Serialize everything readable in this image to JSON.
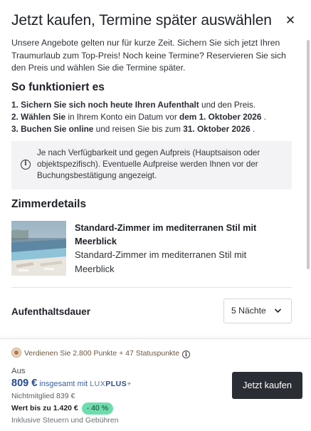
{
  "header": {
    "title": "Jetzt kaufen, Termine später auswählen",
    "close_icon": "close-icon"
  },
  "intro": "Unsere Angebote gelten nur für kurze Zeit. Sichern Sie sich jetzt Ihren Traumurlaub zum Top-Preis! Noch keine Termine? Reservieren Sie sich den Preis und wählen Sie die Termine später.",
  "how": {
    "title": "So funktioniert es",
    "steps": [
      {
        "bold": "1. Sichern Sie sich noch heute Ihren Aufenthalt",
        "rest": " und den Preis."
      },
      {
        "bold": "2. Wählen Sie",
        "mid": " in Ihrem Konto ein Datum vor ",
        "bold2": "dem 1. Oktober 2026 ",
        "end": "."
      },
      {
        "bold": "3. Buchen Sie online",
        "mid": " und reisen Sie bis zum ",
        "bold2": "31. Oktober 2026",
        "end": " ."
      }
    ]
  },
  "info": {
    "icon": "info-icon",
    "text": "Je nach Verfügbarkeit und gegen Aufpreis (Hauptsaison oder objektspezifisch). Eventuelle Aufpreise werden Ihnen vor der Buchungsbestätigung angezeigt."
  },
  "room": {
    "section_title": "Zimmerdetails",
    "name": "Standard-Zimmer im mediterranen Stil mit Meerblick",
    "subtitle": "Standard-Zimmer im mediterranen Stil mit Meerblick"
  },
  "stay": {
    "label": "Aufenthaltsdauer",
    "selected": "5 Nächte",
    "chevron_icon": "chevron-down-icon"
  },
  "footer": {
    "points_text": "Verdienen Sie 2.800 Punkte + 47 Statuspunkte",
    "from_label": "Aus",
    "price": "809 €",
    "price_suffix": "insgesamt mit",
    "lux_prefix": "LUX",
    "lux_bold": "PLUS",
    "lux_plus": "+",
    "non_member": "Nichtmitglied 839 €",
    "worth_label": "Wert bis zu 1.420 €",
    "discount": "- 40 %",
    "taxes": "Inklusive Steuern und Gebühren",
    "buy_button": "Jetzt kaufen"
  },
  "colors": {
    "brand_dark": "#2a2d33",
    "price_blue": "#234b8e",
    "discount_green": "#6fdcae",
    "points_brown": "#6a5840"
  }
}
